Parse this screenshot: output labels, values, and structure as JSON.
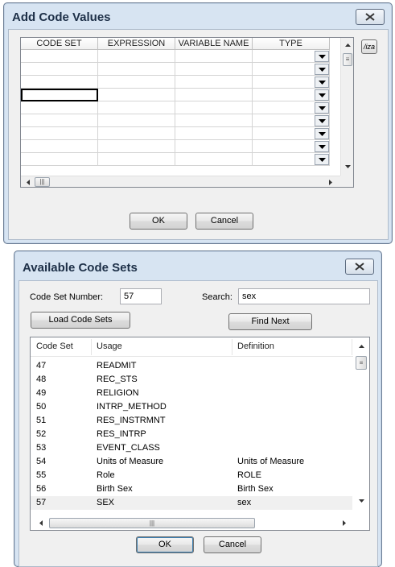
{
  "add_dialog": {
    "title": "Add Code Values",
    "columns": [
      "CODE SET",
      "EXPRESSION",
      "VARIABLE NAME",
      "TYPE"
    ],
    "row_count": 9,
    "side_button_label": "/iza",
    "ok_label": "OK",
    "cancel_label": "Cancel"
  },
  "available_dialog": {
    "title": "Available Code Sets",
    "code_set_number_label": "Code Set Number:",
    "code_set_number_value": "57",
    "search_label": "Search:",
    "search_value": "sex",
    "load_button_label": "Load Code Sets",
    "find_next_label": "Find Next",
    "columns": [
      "Code Set",
      "Usage",
      "Definition"
    ],
    "rows": [
      {
        "code_set": "47",
        "usage": "READMIT",
        "definition": ""
      },
      {
        "code_set": "48",
        "usage": "REC_STS",
        "definition": ""
      },
      {
        "code_set": "49",
        "usage": "RELIGION",
        "definition": ""
      },
      {
        "code_set": "50",
        "usage": "INTRP_METHOD",
        "definition": ""
      },
      {
        "code_set": "51",
        "usage": "RES_INSTRMNT",
        "definition": ""
      },
      {
        "code_set": "52",
        "usage": "RES_INTRP",
        "definition": ""
      },
      {
        "code_set": "53",
        "usage": "EVENT_CLASS",
        "definition": ""
      },
      {
        "code_set": "54",
        "usage": "Units of Measure",
        "definition": "Units of Measure"
      },
      {
        "code_set": "55",
        "usage": "Role",
        "definition": "ROLE"
      },
      {
        "code_set": "56",
        "usage": "Birth Sex",
        "definition": "Birth Sex"
      },
      {
        "code_set": "57",
        "usage": "SEX",
        "definition": "sex"
      }
    ],
    "selected_row": "57",
    "ok_label": "OK",
    "cancel_label": "Cancel"
  },
  "icons": {
    "close": "close-icon",
    "dropdown": "chevron-down-icon",
    "scroll_up": "arrow-up-icon",
    "scroll_down": "arrow-down-icon",
    "scroll_left": "arrow-left-icon",
    "scroll_right": "arrow-right-icon"
  },
  "colors": {
    "dialog_frame": "#d7e4f2",
    "title_text": "#1d2f47",
    "client_bg": "#f0f0f0",
    "selected_row_bg": "#f0f0f0"
  }
}
